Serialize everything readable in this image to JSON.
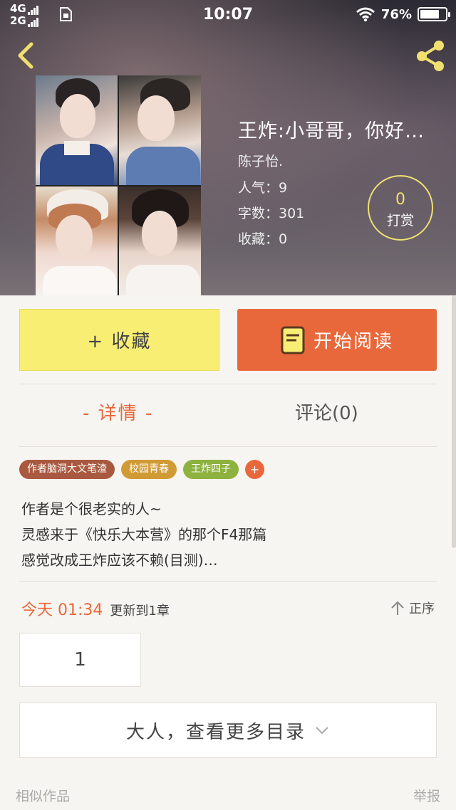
{
  "status_bar": {
    "network_top": "4G",
    "network_bottom": "2G",
    "time": "10:07",
    "battery": "76%",
    "battery_level": 0.76
  },
  "header": {
    "back_icon": "chevron-left-icon",
    "share_icon": "share-icon",
    "accent_color": "#f0e070"
  },
  "book": {
    "title": "王炸:小哥哥，你好…",
    "author": "陈子怡.",
    "popularity": "人气：9",
    "words": "字数：301",
    "favorites": "收藏：0",
    "reward_count": "0",
    "reward_label": "打赏"
  },
  "actions": {
    "favorite_label": "+ 收藏",
    "read_label": "开始阅读",
    "read_icon": "book-icon",
    "favorite_color": "#f8ee74",
    "read_color": "#e8683c"
  },
  "tabs": {
    "detail": "- 详情 -",
    "comments": "评论(0)"
  },
  "tags": [
    "作者脑洞大文笔渣",
    "校园青春",
    "王炸四子",
    "+"
  ],
  "description": [
    "作者是个很老实的人~",
    "灵感来于《快乐大本营》的那个F4那篇",
    "感觉改成王炸应该不赖(目测)…"
  ],
  "update": {
    "time": "今天 01:34",
    "label": "更新到1章",
    "order": "正序",
    "order_icon": "arrow-up-icon"
  },
  "chapters": [
    "1"
  ],
  "more_directory": "大人，查看更多目录",
  "footer": {
    "similar": "相似作品",
    "report": "举报"
  }
}
